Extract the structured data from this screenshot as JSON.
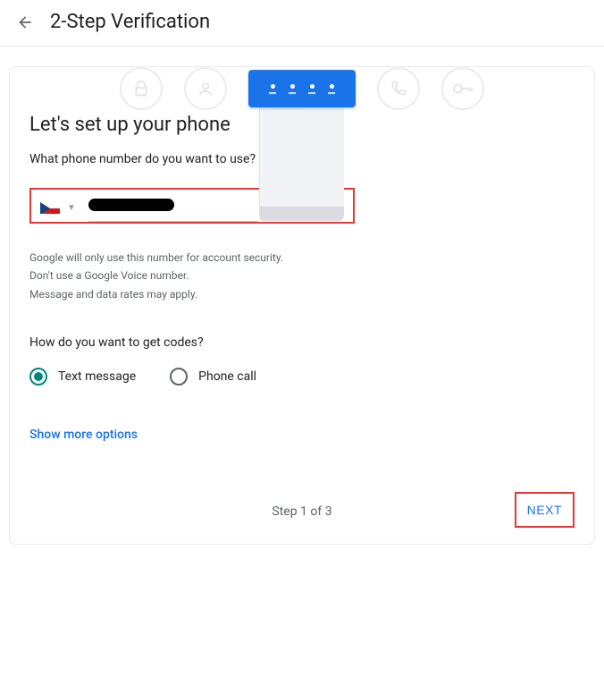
{
  "header": {
    "title": "2-Step Verification"
  },
  "main": {
    "heading": "Let's set up your phone",
    "question": "What phone number do you want to use?",
    "helper_line1": "Google will only use this number for account security.",
    "helper_line2": "Don't use a Google Voice number.",
    "helper_line3": "Message and data rates may apply.",
    "codes_question": "How do you want to get codes?",
    "radio": {
      "text_message": "Text message",
      "phone_call": "Phone call"
    },
    "show_more": "Show more options",
    "step_text": "Step 1 of 3",
    "next_label": "NEXT",
    "country_code": "CZ"
  }
}
